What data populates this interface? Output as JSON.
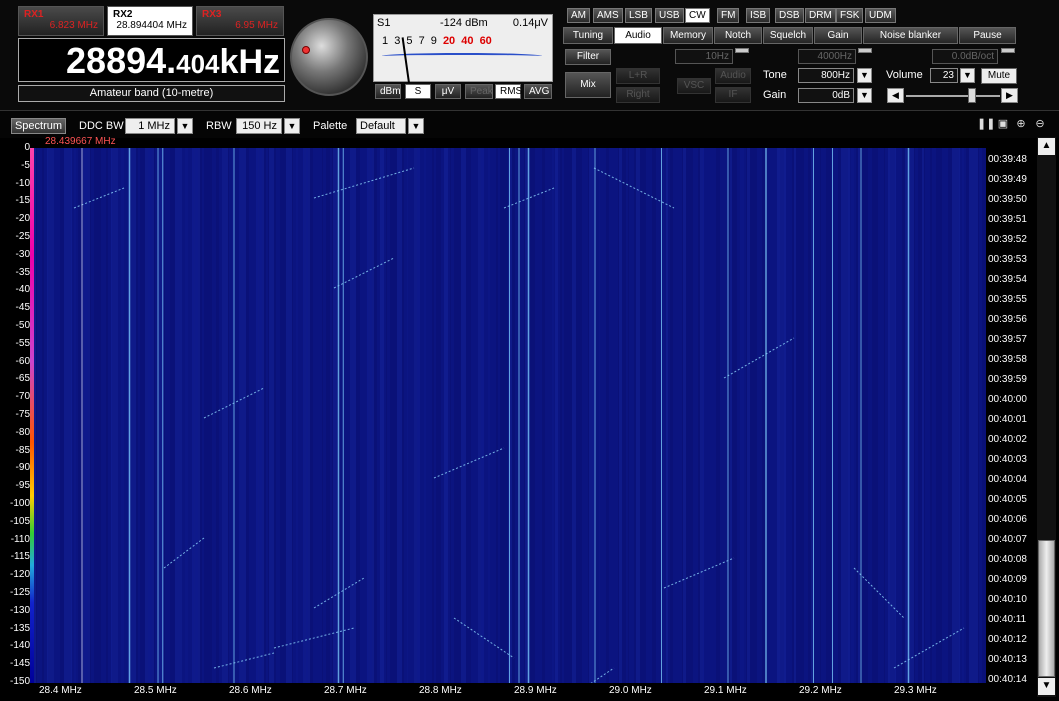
{
  "receivers": [
    {
      "label": "RX1",
      "freq": "6.823 MHz",
      "active": false
    },
    {
      "label": "RX2",
      "freq": "28.894404 MHz",
      "active": true
    },
    {
      "label": "RX3",
      "freq": "6.95 MHz",
      "active": false
    }
  ],
  "main_freq": {
    "big": "28894.",
    "small": "404",
    "unit": "kHz"
  },
  "band_name": "Amateur band (10-metre)",
  "smeter": {
    "label": "S1",
    "level": "-124 dBm",
    "uv": "0.14μV",
    "scale": [
      "1",
      "3",
      "5",
      "7",
      "9",
      "20",
      "40",
      "60"
    ],
    "buttons": [
      "dBm",
      "S",
      "μV",
      "Peak",
      "RMS",
      "AVG"
    ],
    "selected": [
      "S",
      "RMS"
    ]
  },
  "modes": [
    "AM",
    "AMS",
    "LSB",
    "USB",
    "CW",
    "FM",
    "ISB",
    "DSB",
    "DRM",
    "FSK",
    "UDM"
  ],
  "selected_mode": "CW",
  "tabs": [
    "Tuning",
    "Audio",
    "Memory",
    "Notch",
    "Squelch",
    "Gain",
    "Noise blanker",
    "Pause"
  ],
  "selected_tab": "Audio",
  "audio": {
    "filter_label": "Filter",
    "mix_label": "Mix",
    "filter_low": "10Hz",
    "filter_high": "4000Hz",
    "slope": "0.0dB/oct",
    "lr_label": "L+R",
    "right_label": "Right",
    "vsc_label": "VSC",
    "audio_label": "Audio",
    "if_label": "IF",
    "tone_label": "Tone",
    "tone_value": "800Hz",
    "gain_label": "Gain",
    "gain_value": "0dB",
    "volume_label": "Volume",
    "volume_value": "23",
    "mute_label": "Mute"
  },
  "ctrlbar": {
    "spectrum": "Spectrum",
    "ddc_label": "DDC BW",
    "ddc_value": "1 MHz",
    "rbw_label": "RBW",
    "rbw_value": "150 Hz",
    "palette_label": "Palette",
    "palette_value": "Default"
  },
  "marker_freq": "28.439667 MHz",
  "y_ticks": [
    "0",
    "-5",
    "-10",
    "-15",
    "-20",
    "-25",
    "-30",
    "-35",
    "-40",
    "-45",
    "-50",
    "-55",
    "-60",
    "-65",
    "-70",
    "-75",
    "-80",
    "-85",
    "-90",
    "-95",
    "-100",
    "-105",
    "-110",
    "-115",
    "-120",
    "-125",
    "-130",
    "-135",
    "-140",
    "-145",
    "-150"
  ],
  "x_ticks": [
    "28.4 MHz",
    "28.5 MHz",
    "28.6 MHz",
    "28.7 MHz",
    "28.8 MHz",
    "28.9 MHz",
    "29.0 MHz",
    "29.1 MHz",
    "29.2 MHz",
    "29.3 MHz"
  ],
  "time_ticks": [
    "00:39:48",
    "00:39:49",
    "00:39:50",
    "00:39:51",
    "00:39:52",
    "00:39:53",
    "00:39:54",
    "00:39:55",
    "00:39:56",
    "00:39:57",
    "00:39:58",
    "00:39:59",
    "00:40:00",
    "00:40:01",
    "00:40:02",
    "00:40:03",
    "00:40:04",
    "00:40:05",
    "00:40:06",
    "00:40:07",
    "00:40:08",
    "00:40:09",
    "00:40:10",
    "00:40:11",
    "00:40:12",
    "00:40:13",
    "00:40:14"
  ],
  "waterfall_lines_mhz": [
    28.49,
    28.52,
    28.525,
    28.6,
    28.71,
    28.715,
    28.89,
    28.9,
    28.91,
    28.98,
    29.05,
    29.12,
    29.16,
    29.21,
    29.23,
    29.26,
    29.31,
    29.41
  ],
  "colors": {
    "waterfall_bg": "#0a1178",
    "signal": "#7fd0ff",
    "accent_red": "#dd2222"
  }
}
